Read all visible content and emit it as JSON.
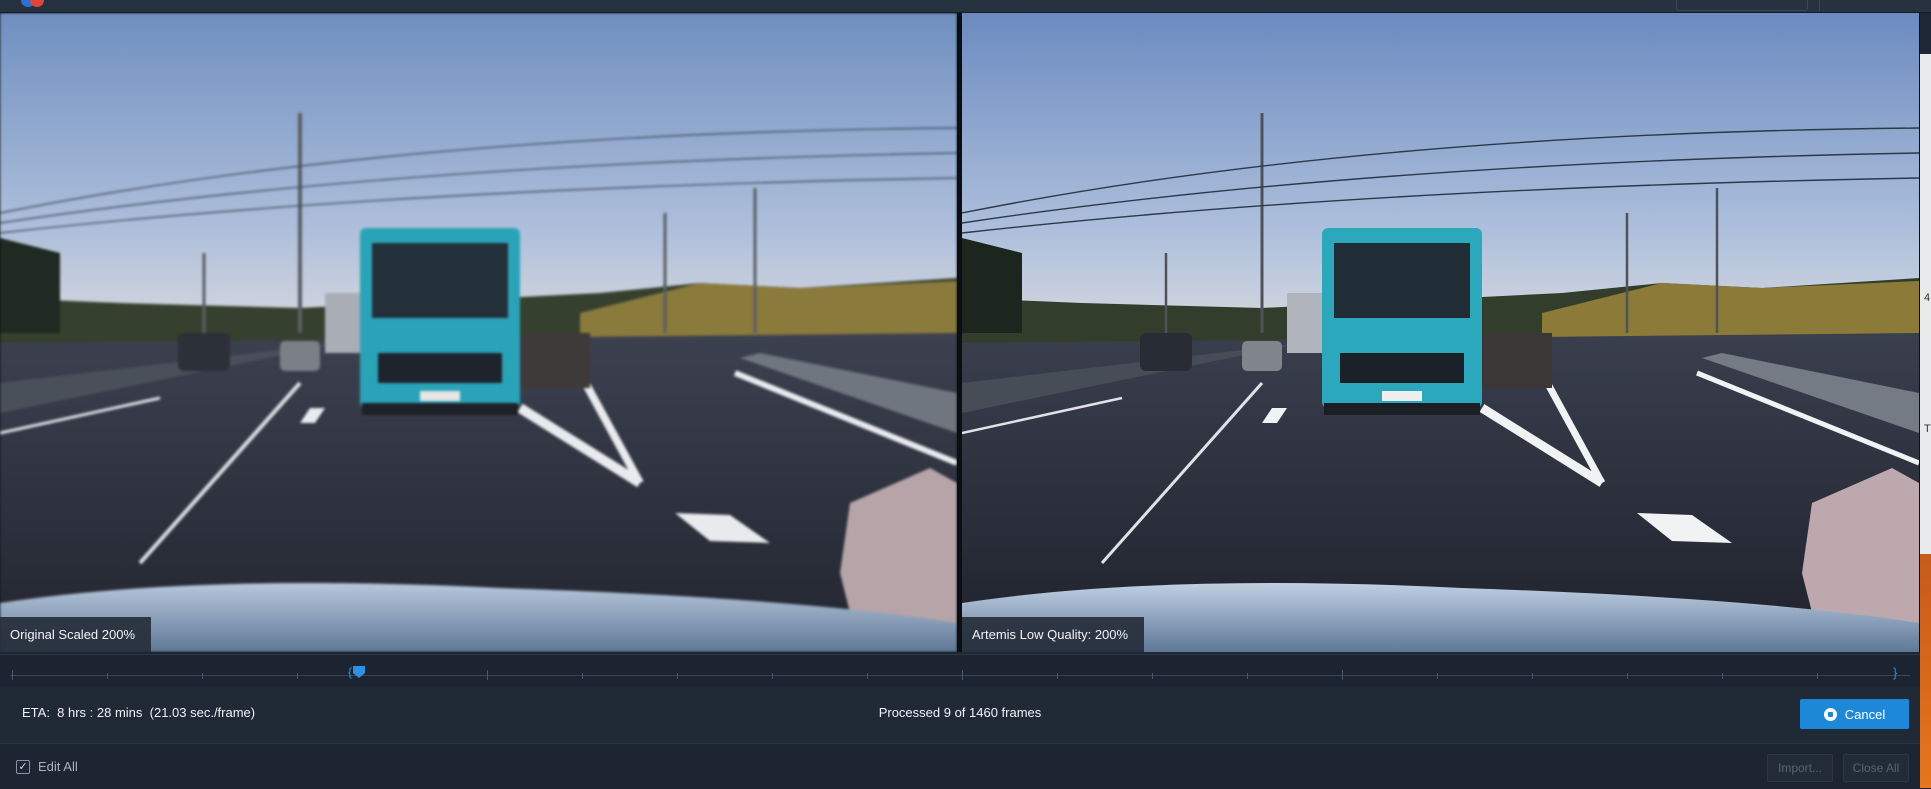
{
  "window": {
    "logo_icon": "app-logo-icon"
  },
  "viewer": {
    "left_label": "Original Scaled 200%",
    "right_label": "Artemis Low Quality: 200%",
    "image_description_icon": "dashcam-road-scene"
  },
  "timeline": {
    "range_start_glyph": "{",
    "range_end_glyph": "}",
    "playhead_icon": "playhead-marker-icon"
  },
  "status": {
    "eta": "ETA:  8 hrs : 28 mins  (21.03 sec./frame)",
    "processed": "Processed 9 of 1460 frames",
    "cancel_label": "Cancel",
    "cancel_icon": "stop-circle-icon"
  },
  "footer": {
    "edit_all_label": "Edit All",
    "edit_all_checked": true,
    "import_label": "Import...",
    "close_all_label": "Close All"
  },
  "side_edge": {
    "glyph_1": "4",
    "glyph_2": "T"
  },
  "colors": {
    "accent": "#1e88d8",
    "background": "#1e2835",
    "bus": "#2aa3b8"
  }
}
